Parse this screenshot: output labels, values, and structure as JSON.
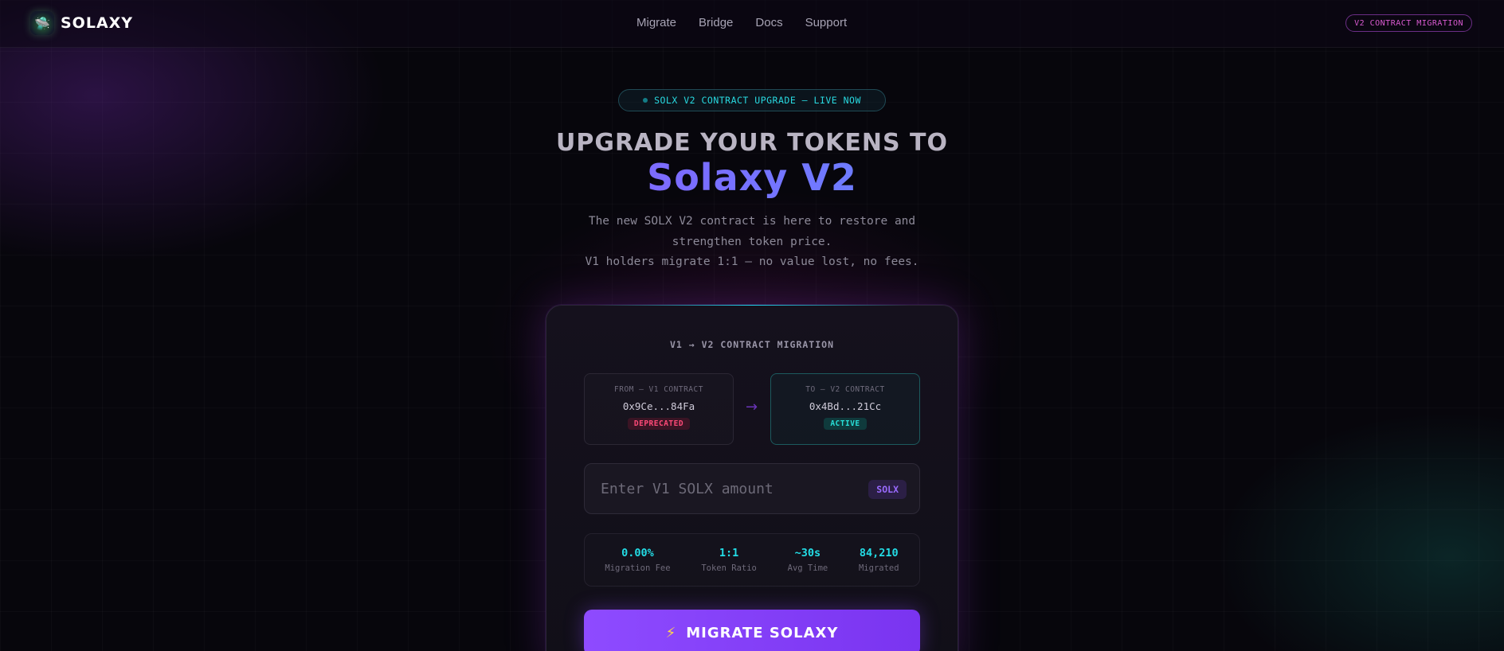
{
  "nav": {
    "logo_text": "SOLAXY",
    "links": [
      "Migrate",
      "Bridge",
      "Docs",
      "Support"
    ],
    "badge": "V2 CONTRACT MIGRATION"
  },
  "hero": {
    "pill": "SOLX V2 CONTRACT UPGRADE — LIVE NOW",
    "line1": "UPGRADE YOUR TOKENS TO",
    "line2": "Solaxy V2",
    "desc_line1": "The new SOLX V2 contract is here to restore and",
    "desc_line2": "strengthen token price.",
    "desc_line3": "V1 holders migrate 1:1 — no value lost, no fees."
  },
  "card": {
    "title": "V1 → V2 CONTRACT MIGRATION",
    "from": {
      "label": "FROM — V1 CONTRACT",
      "address": "0x9Ce...84Fa",
      "status": "DEPRECATED"
    },
    "to": {
      "label": "TO — V2 CONTRACT",
      "address": "0x4Bd...21Cc",
      "status": "ACTIVE"
    },
    "arrow": "→",
    "amount_placeholder": "Enter V1 SOLX amount",
    "token": "SOLX",
    "stats": [
      {
        "value": "0.00%",
        "label": "Migration Fee"
      },
      {
        "value": "1:1",
        "label": "Token Ratio"
      },
      {
        "value": "~30s",
        "label": "Avg Time"
      },
      {
        "value": "84,210",
        "label": "Migrated"
      }
    ],
    "button": "MIGRATE SOLAXY"
  },
  "colors": {
    "accent_purple": "#8e4bff",
    "accent_cyan": "#23dde6",
    "danger": "#ff4a78",
    "background": "#07060c"
  }
}
